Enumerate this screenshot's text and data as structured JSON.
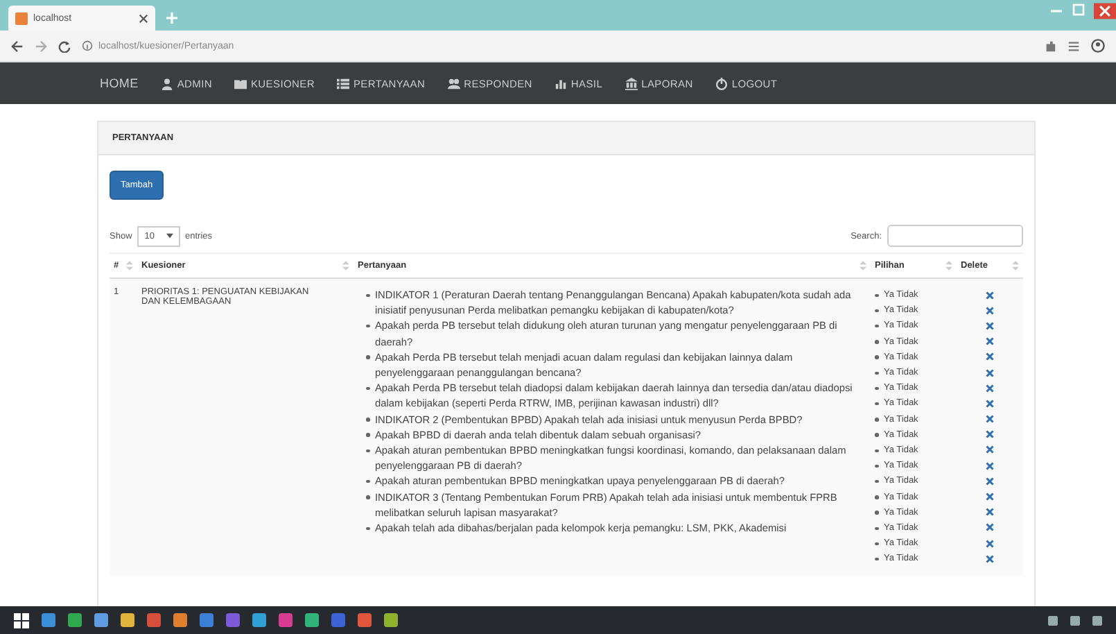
{
  "browser": {
    "tab_title": "localhost",
    "url": "localhost/kuesioner/Pertanyaan"
  },
  "nav": [
    {
      "label": "HOME",
      "kind": "text"
    },
    {
      "label": "ADMIN",
      "kind": "icon"
    },
    {
      "label": "KUESIONER",
      "kind": "icon"
    },
    {
      "label": "PERTANYAAN",
      "kind": "icon"
    },
    {
      "label": "RESPONDEN",
      "kind": "icon"
    },
    {
      "label": "HASIL",
      "kind": "icon"
    },
    {
      "label": "LAPORAN",
      "kind": "icon"
    },
    {
      "label": "LOGOUT",
      "kind": "icon"
    }
  ],
  "panel": {
    "title": "PERTANYAAN",
    "add_button": "Tambah"
  },
  "length": {
    "before": "Show",
    "value": "10",
    "after": "entries"
  },
  "search": {
    "label": "Search:"
  },
  "table": {
    "columns": [
      "#",
      "Kuesioner",
      "Pertanyaan",
      "Pilihan",
      "Delete"
    ],
    "rows": [
      {
        "number": "1",
        "kuesioner": "PRIORITAS 1: PENGUATAN KEBIJAKAN DAN KELEMBAGAAN",
        "questions": [
          "INDIKATOR 1 (Peraturan Daerah tentang Penanggulangan Bencana) Apakah kabupaten/kota sudah ada inisiatif penyusunan Perda melibatkan pemangku kebijakan di kabupaten/kota?",
          "Apakah perda PB tersebut telah didukung oleh aturan turunan yang mengatur penyelenggaraan PB di daerah?",
          "Apakah Perda PB tersebut telah menjadi acuan dalam regulasi dan kebijakan lainnya dalam penyelenggaraan penanggulangan bencana?",
          "Apakah Perda PB tersebut telah diadopsi dalam kebijakan daerah lainnya dan tersedia dan/atau diadopsi dalam kebijakan (seperti Perda RTRW, IMB, perijinan kawasan industri) dll?",
          "INDIKATOR 2 (Pembentukan BPBD) Apakah telah ada inisiasi untuk menyusun Perda BPBD?",
          "Apakah BPBD di daerah anda telah dibentuk dalam sebuah organisasi?",
          "Apakah aturan pembentukan BPBD meningkatkan fungsi koordinasi, komando, dan pelaksanaan dalam penyelenggaraan PB di daerah?",
          "Apakah aturan pembentukan BPBD meningkatkan upaya penyelenggaraan PB di daerah?",
          "INDIKATOR 3 (Tentang Pembentukan Forum PRB) Apakah telah ada inisiasi untuk membentuk FPRB melibatkan seluruh lapisan masyarakat?",
          "Apakah telah ada dibahas/berjalan pada kelompok kerja pemangku: LSM, PKK, Akademisi"
        ],
        "choices": [
          "Ya Tidak",
          "Ya Tidak",
          "Ya Tidak",
          "Ya Tidak",
          "Ya Tidak",
          "Ya Tidak",
          "Ya Tidak",
          "Ya Tidak",
          "Ya Tidak",
          "Ya Tidak",
          "Ya Tidak",
          "Ya Tidak",
          "Ya Tidak",
          "Ya Tidak",
          "Ya Tidak",
          "Ya Tidak",
          "Ya Tidak",
          "Ya Tidak"
        ]
      }
    ]
  }
}
